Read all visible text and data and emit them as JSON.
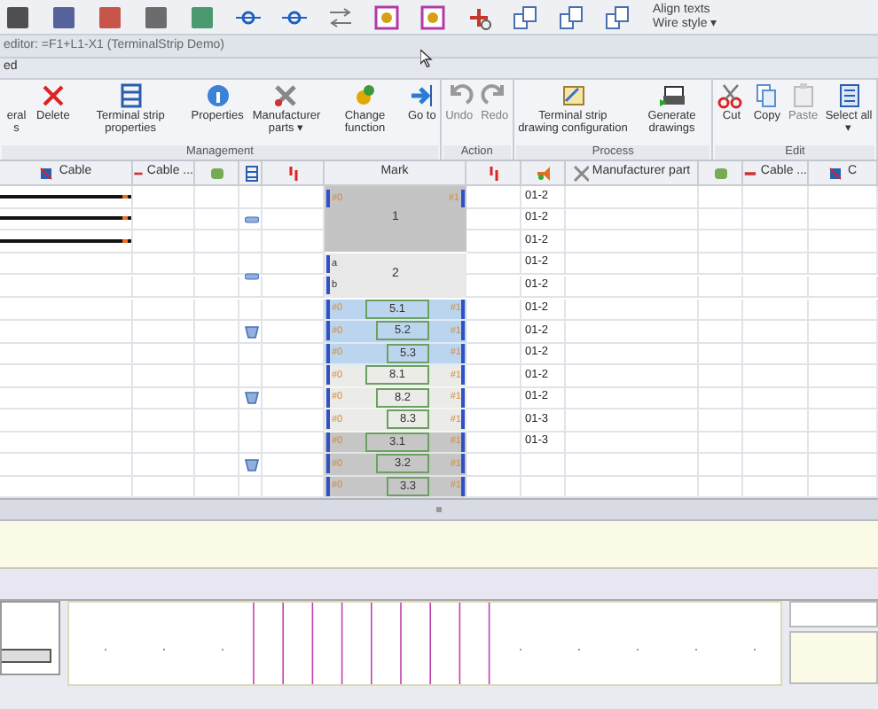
{
  "toolbar": {
    "texts": [
      "Align texts",
      "Wire style ▾"
    ]
  },
  "window": {
    "title": "editor: =F1+L1-X1 (TerminalStrip Demo)"
  },
  "tab_strip": {
    "label": "ed"
  },
  "ribbon": [
    {
      "label": "Management",
      "buttons": [
        {
          "label": "eral s",
          "disabled": false
        },
        {
          "label": "Delete",
          "disabled": false
        },
        {
          "label": "Terminal strip properties",
          "disabled": false
        },
        {
          "label": "Properties",
          "disabled": false
        },
        {
          "label": "Manufacturer parts ▾",
          "disabled": false
        },
        {
          "label": "Change function",
          "disabled": false
        },
        {
          "label": "Go to",
          "disabled": false
        }
      ]
    },
    {
      "label": "Action",
      "buttons": [
        {
          "label": "Undo",
          "disabled": true
        },
        {
          "label": "Redo",
          "disabled": true
        }
      ]
    },
    {
      "label": "Process",
      "buttons": [
        {
          "label": "Terminal strip drawing configuration",
          "disabled": false
        },
        {
          "label": "Generate drawings",
          "disabled": false
        }
      ]
    },
    {
      "label": "Edit",
      "buttons": [
        {
          "label": "Cut",
          "disabled": false
        },
        {
          "label": "Copy",
          "disabled": false
        },
        {
          "label": "Paste",
          "disabled": true
        },
        {
          "label": "Select all ▾",
          "disabled": false
        }
      ]
    }
  ],
  "table": {
    "columns": [
      {
        "kind": "text",
        "label": "Cable"
      },
      {
        "kind": "text",
        "label": "Cable ..."
      },
      {
        "kind": "icon"
      },
      {
        "kind": "icon"
      },
      {
        "kind": "icon"
      },
      {
        "kind": "text",
        "label": "Mark"
      },
      {
        "kind": "icon"
      },
      {
        "kind": "icon"
      },
      {
        "kind": "text",
        "label": "Manufacturer part"
      },
      {
        "kind": "icon"
      },
      {
        "kind": "text",
        "label": "Cable ..."
      },
      {
        "kind": "text",
        "label": "C"
      }
    ],
    "groups": [
      {
        "kind": "merged",
        "mark": "1",
        "color": "#c4c4c4",
        "rows": [
          {
            "left": "#0",
            "right": "#1",
            "wire": true,
            "value": "01-2"
          },
          {
            "wire": true,
            "value": "01-2"
          },
          {
            "wire": true,
            "value": "01-2"
          }
        ]
      },
      {
        "kind": "merged",
        "mark": "2",
        "color": "#e8e8e8",
        "rows": [
          {
            "left": "a",
            "wire": false,
            "value": "01-2"
          },
          {
            "left": "b",
            "wire": false,
            "value": "01-2"
          }
        ]
      },
      {
        "kind": "levels",
        "color": "#bcd5ee",
        "rows": [
          {
            "left": "#0",
            "mark": "5.1",
            "right": "#1",
            "wire": false,
            "value": "01-2"
          },
          {
            "left": "#0",
            "mark": "5.2",
            "right": "#1",
            "wire": false,
            "value": "01-2"
          },
          {
            "left": "#0",
            "mark": "5.3",
            "right": "#1",
            "wire": false,
            "value": "01-2"
          }
        ]
      },
      {
        "kind": "levels",
        "color": "#ebebe8",
        "rows": [
          {
            "left": "#0",
            "mark": "8.1",
            "right": "#1",
            "wire": false,
            "value": "01-2"
          },
          {
            "left": "#0",
            "mark": "8.2",
            "right": "#1",
            "wire": false,
            "value": "01-2"
          },
          {
            "left": "#0",
            "mark": "8.3",
            "right": "#1",
            "wire": false,
            "value": "01-3"
          }
        ]
      },
      {
        "kind": "levels",
        "color": "#c6c6c6",
        "rows": [
          {
            "left": "#0",
            "mark": "3.1",
            "right": "#1",
            "wire": false,
            "value": "01-3"
          },
          {
            "left": "#0",
            "mark": "3.2",
            "right": "#1",
            "wire": false
          },
          {
            "left": "#0",
            "mark": "3.3",
            "right": "#1",
            "wire": false
          }
        ]
      }
    ]
  }
}
